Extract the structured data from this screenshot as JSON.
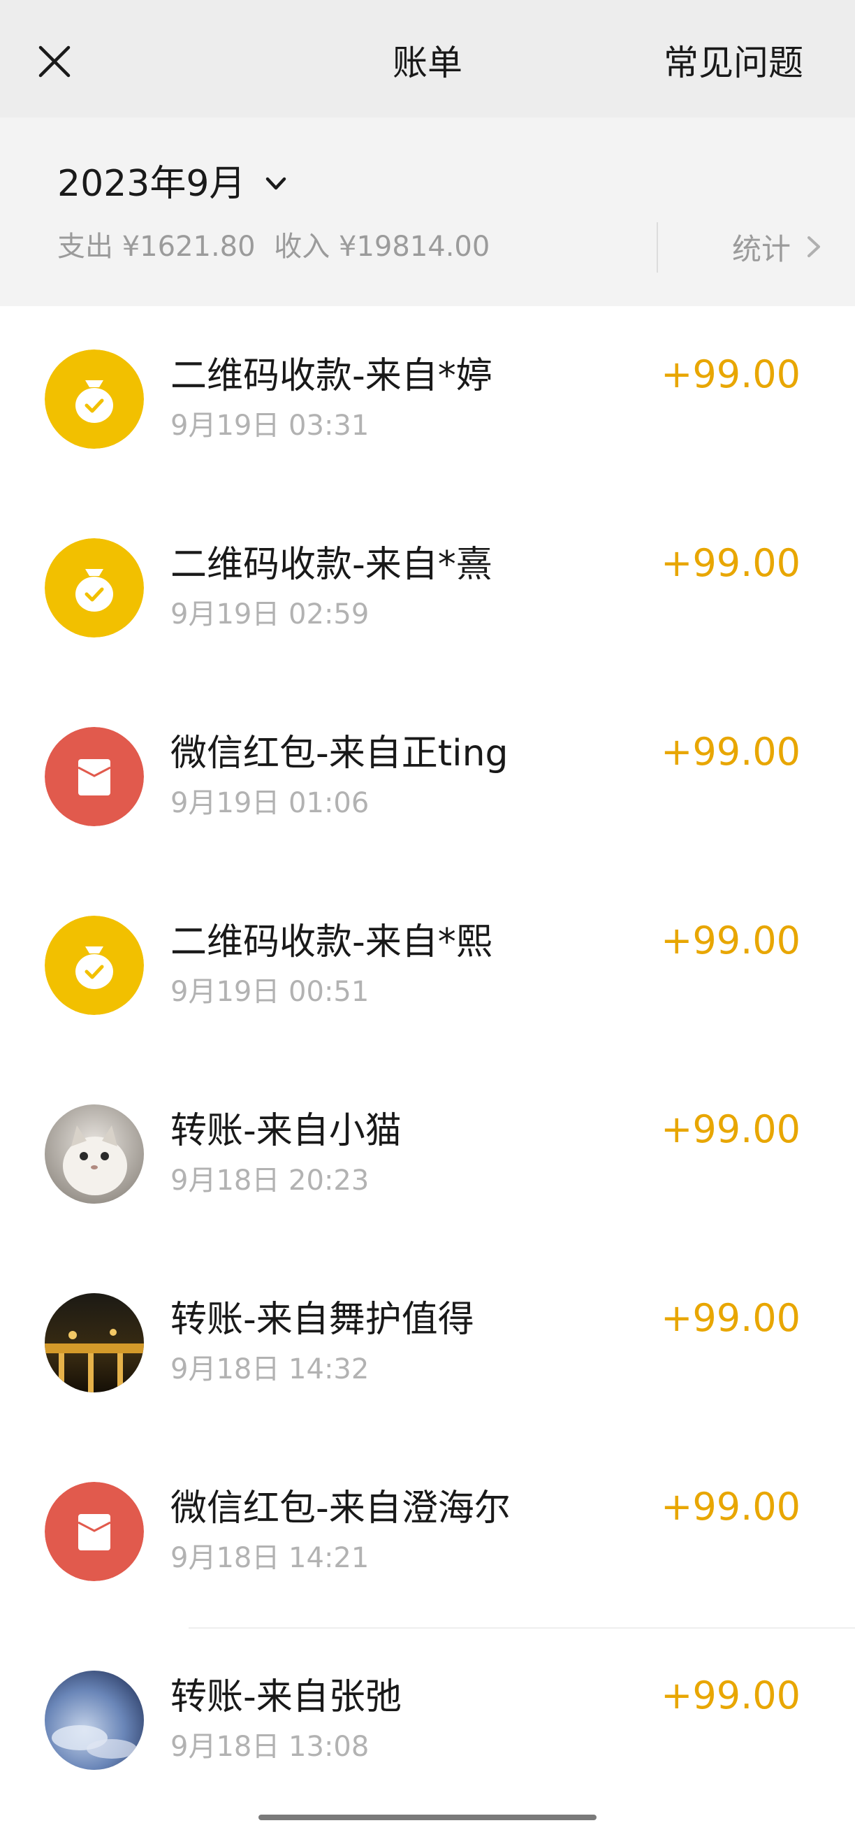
{
  "navbar": {
    "title": "账单",
    "faq_label": "常见问题",
    "close_icon": "close-icon"
  },
  "summary": {
    "month": "2023年9月",
    "totals": {
      "expense_label": "支出",
      "expense_value": "¥1621.80",
      "income_label": "收入",
      "income_value": "¥19814.00"
    },
    "stat_label": "统计"
  },
  "colors": {
    "amount": "#e8a600",
    "qr_icon_bg": "#f2c000",
    "red_packet_bg": "#e15a4d"
  },
  "transactions": [
    {
      "icon": "qr-payment-icon",
      "title": "二维码收款-来自*婷",
      "time": "9月19日 03:31",
      "amount": "+99.00"
    },
    {
      "icon": "qr-payment-icon",
      "title": "二维码收款-来自*熹",
      "time": "9月19日 02:59",
      "amount": "+99.00"
    },
    {
      "icon": "red-packet-icon",
      "title": "微信红包-来自正ting",
      "time": "9月19日 01:06",
      "amount": "+99.00"
    },
    {
      "icon": "qr-payment-icon",
      "title": "二维码收款-来自*熙",
      "time": "9月19日 00:51",
      "amount": "+99.00"
    },
    {
      "icon": "avatar-cat",
      "title": "转账-来自小猫",
      "time": "9月18日 20:23",
      "amount": "+99.00"
    },
    {
      "icon": "avatar-night",
      "title": "转账-来自舞护值得",
      "time": "9月18日 14:32",
      "amount": "+99.00"
    },
    {
      "icon": "red-packet-icon",
      "title": "微信红包-来自澄海尔",
      "time": "9月18日 14:21",
      "amount": "+99.00"
    },
    {
      "icon": "avatar-sky",
      "title": "转账-来自张弛",
      "time": "9月18日 13:08",
      "amount": "+99.00"
    }
  ]
}
